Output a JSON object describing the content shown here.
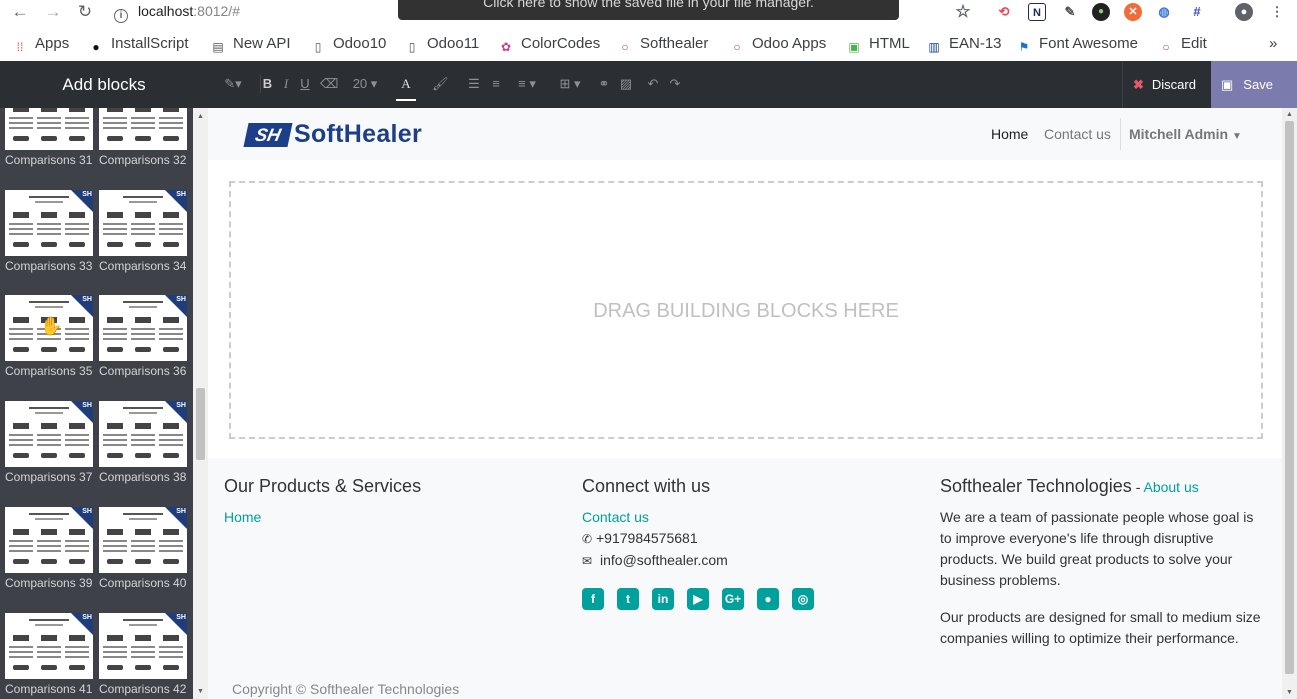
{
  "browser": {
    "url_host": "localhost",
    "url_rest": ":8012/#",
    "toast": "Click here to show the saved file in your file manager.",
    "bookmarks": [
      "Apps",
      "InstallScript",
      "New API",
      "Odoo10",
      "Odoo11",
      "ColorCodes",
      "Softhealer",
      "Odoo Apps",
      "HTML",
      "EAN-13",
      "Font Awesome",
      "Edit"
    ],
    "more": "»"
  },
  "editor": {
    "panel_title": "Add blocks",
    "font_size": "20",
    "discard_label": "Discard",
    "save_label": "Save"
  },
  "sidebar": {
    "blocks": [
      "Comparisons 31",
      "Comparisons 32",
      "Comparisons 33",
      "Comparisons 34",
      "Comparisons 35",
      "Comparisons 36",
      "Comparisons 37",
      "Comparisons 38",
      "Comparisons 39",
      "Comparisons 40",
      "Comparisons 41",
      "Comparisons 42"
    ],
    "badge": "SH"
  },
  "site": {
    "logo_mark": "SH",
    "logo_text": "SoftHealer",
    "menu": [
      "Home",
      "Contact us"
    ],
    "user": "Mitchell Admin",
    "dropzone": "DRAG BUILDING BLOCKS HERE"
  },
  "footer": {
    "col1": {
      "title": "Our Products & Services",
      "links": [
        "Home"
      ]
    },
    "col2": {
      "title": "Connect with us",
      "link": "Contact us",
      "phone": "+917984575681",
      "email": "info@softhealer.com"
    },
    "col3": {
      "title": "Softhealer Technologies",
      "sep": " - ",
      "about": "About us",
      "p1_lines": [
        "We are a team of passionate people whose goal is",
        "to improve everyone's life through disruptive",
        "products. We build great products to solve your",
        "business problems."
      ],
      "p2_lines": [
        "Our products are designed for small to medium size",
        "companies willing to optimize their performance."
      ]
    },
    "copyright": "Copyright © Softhealer Technologies"
  }
}
